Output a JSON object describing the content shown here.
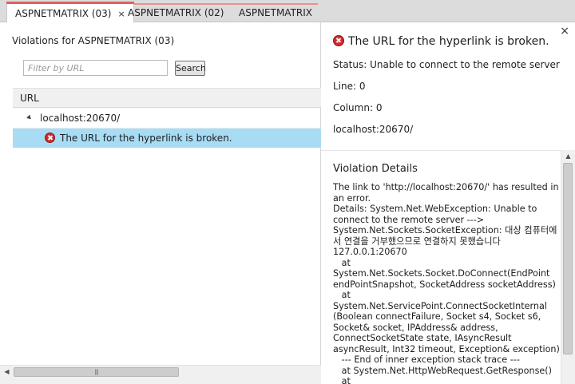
{
  "tabs": [
    {
      "label": "ASPNETMATRIX (03)",
      "active": true,
      "close": "×"
    },
    {
      "label": "ASPNETMATRIX (02)",
      "active": false
    },
    {
      "label": "ASPNETMATRIX",
      "active": false
    }
  ],
  "left": {
    "title": "Violations for ASPNETMATRIX (03)",
    "filter_placeholder": "Filter by URL",
    "search_label": "Search",
    "column_header": "URL",
    "group_row": "localhost:20670/",
    "selected_row": "The URL for the hyperlink is broken.",
    "scroll_grip": "|||"
  },
  "right": {
    "close": "×",
    "title": "The URL for the hyperlink is broken.",
    "status": "Status: Unable to connect to the remote server",
    "line": "Line: 0",
    "column": "Column: 0",
    "url": "localhost:20670/",
    "details_title": "Violation Details",
    "details_text": "The link to 'http://localhost:20670/' has resulted in an error.\nDetails: System.Net.WebException: Unable to connect to the remote server --->\nSystem.Net.Sockets.SocketException: 대상 컴퓨터에서 연결을 거부했으므로 연결하지 못했습니다 127.0.0.1:20670\n   at System.Net.Sockets.Socket.DoConnect(EndPoint endPointSnapshot, SocketAddress socketAddress)\n   at System.Net.ServicePoint.ConnectSocketInternal (Boolean connectFailure, Socket s4, Socket s6, Socket& socket, IPAddress& address, ConnectSocketState state, IAsyncResult asyncResult, Int32 timeout, Exception& exception)\n   --- End of inner exception stack trace ---\n   at System.Net.HttpWebRequest.GetResponse()\n   at\nMicrosoft.Web.Management.SEO.Crawler.UrlDownloader"
  },
  "colors": {
    "selection": "#a8dcf4",
    "error": "#d22b2b",
    "active_tab_accent": "#e06060"
  }
}
